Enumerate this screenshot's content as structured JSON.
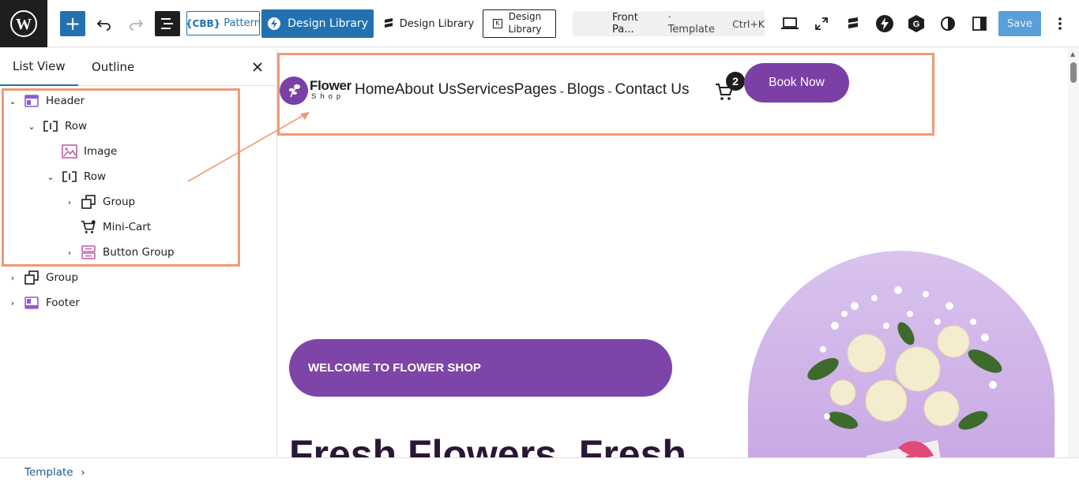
{
  "toolbar": {
    "add_label": "+",
    "cbb_mark": "{CBB}",
    "cbb_label": "Pattern",
    "design_library_primary": "Design Library",
    "design_library_secondary": "Design Library",
    "design_library_boxed": "Design Library",
    "document_title": "Front Pa...",
    "document_kind": "· Template",
    "shortcut": "Ctrl+K",
    "save_label": "Save"
  },
  "sidebar": {
    "tabs": [
      {
        "label": "List View",
        "active": true
      },
      {
        "label": "Outline",
        "active": false
      }
    ],
    "tree": [
      {
        "label": "Header",
        "icon": "template-part-icon",
        "expanded": true
      },
      {
        "label": "Row",
        "icon": "row-icon",
        "expanded": true
      },
      {
        "label": "Image",
        "icon": "image-icon"
      },
      {
        "label": "Row",
        "icon": "row-icon",
        "expanded": true
      },
      {
        "label": "Group",
        "icon": "group-icon",
        "expanded": false
      },
      {
        "label": "Mini-Cart",
        "icon": "cart-icon"
      },
      {
        "label": "Button Group",
        "icon": "button-group-icon",
        "expanded": false
      },
      {
        "label": "Group",
        "icon": "group-icon",
        "expanded": false
      },
      {
        "label": "Footer",
        "icon": "template-part-icon",
        "expanded": false
      }
    ]
  },
  "site": {
    "brand_name": "Flower",
    "brand_sub": "Shop",
    "nav": [
      "Home",
      "About Us",
      "Services",
      "Pages",
      "Blogs",
      "Contact Us"
    ],
    "cart_count": "2",
    "book_label": "Book Now",
    "welcome_label": "WELCOME TO FLOWER SHOP",
    "hero_title": "Fresh Flowers, Fresh"
  },
  "breadcrumb": {
    "label": "Template"
  },
  "colors": {
    "accent": "#2271b1",
    "brand_purple": "#7b3fa6",
    "highlight": "#ef9a74"
  }
}
